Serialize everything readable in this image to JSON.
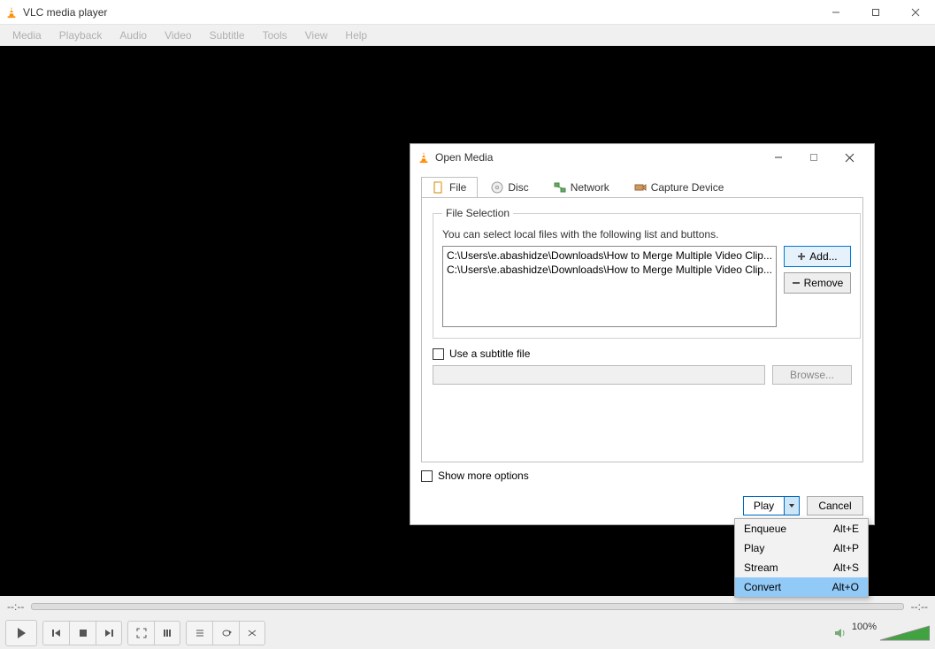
{
  "app": {
    "title": "VLC media player"
  },
  "menubar": [
    "Media",
    "Playback",
    "Audio",
    "Video",
    "Subtitle",
    "Tools",
    "View",
    "Help"
  ],
  "time": {
    "left": "--:--",
    "right": "--:--"
  },
  "volume": {
    "pct": "100%"
  },
  "dialog": {
    "title": "Open Media",
    "tabs": {
      "file": "File",
      "disc": "Disc",
      "network": "Network",
      "capture": "Capture Device"
    },
    "fileSelection": {
      "legend": "File Selection",
      "hint": "You can select local files with the following list and buttons.",
      "items": [
        "C:\\Users\\e.abashidze\\Downloads\\How to Merge Multiple Video Clip...",
        "C:\\Users\\e.abashidze\\Downloads\\How to Merge Multiple Video Clip..."
      ],
      "add": "Add...",
      "remove": "Remove"
    },
    "subtitles": {
      "label": "Use a subtitle file",
      "browse": "Browse..."
    },
    "moreOptions": "Show more options",
    "play": "Play",
    "cancel": "Cancel"
  },
  "dropdown": [
    {
      "label": "Enqueue",
      "shortcut": "Alt+E"
    },
    {
      "label": "Play",
      "shortcut": "Alt+P"
    },
    {
      "label": "Stream",
      "shortcut": "Alt+S"
    },
    {
      "label": "Convert",
      "shortcut": "Alt+O",
      "selected": true
    }
  ]
}
